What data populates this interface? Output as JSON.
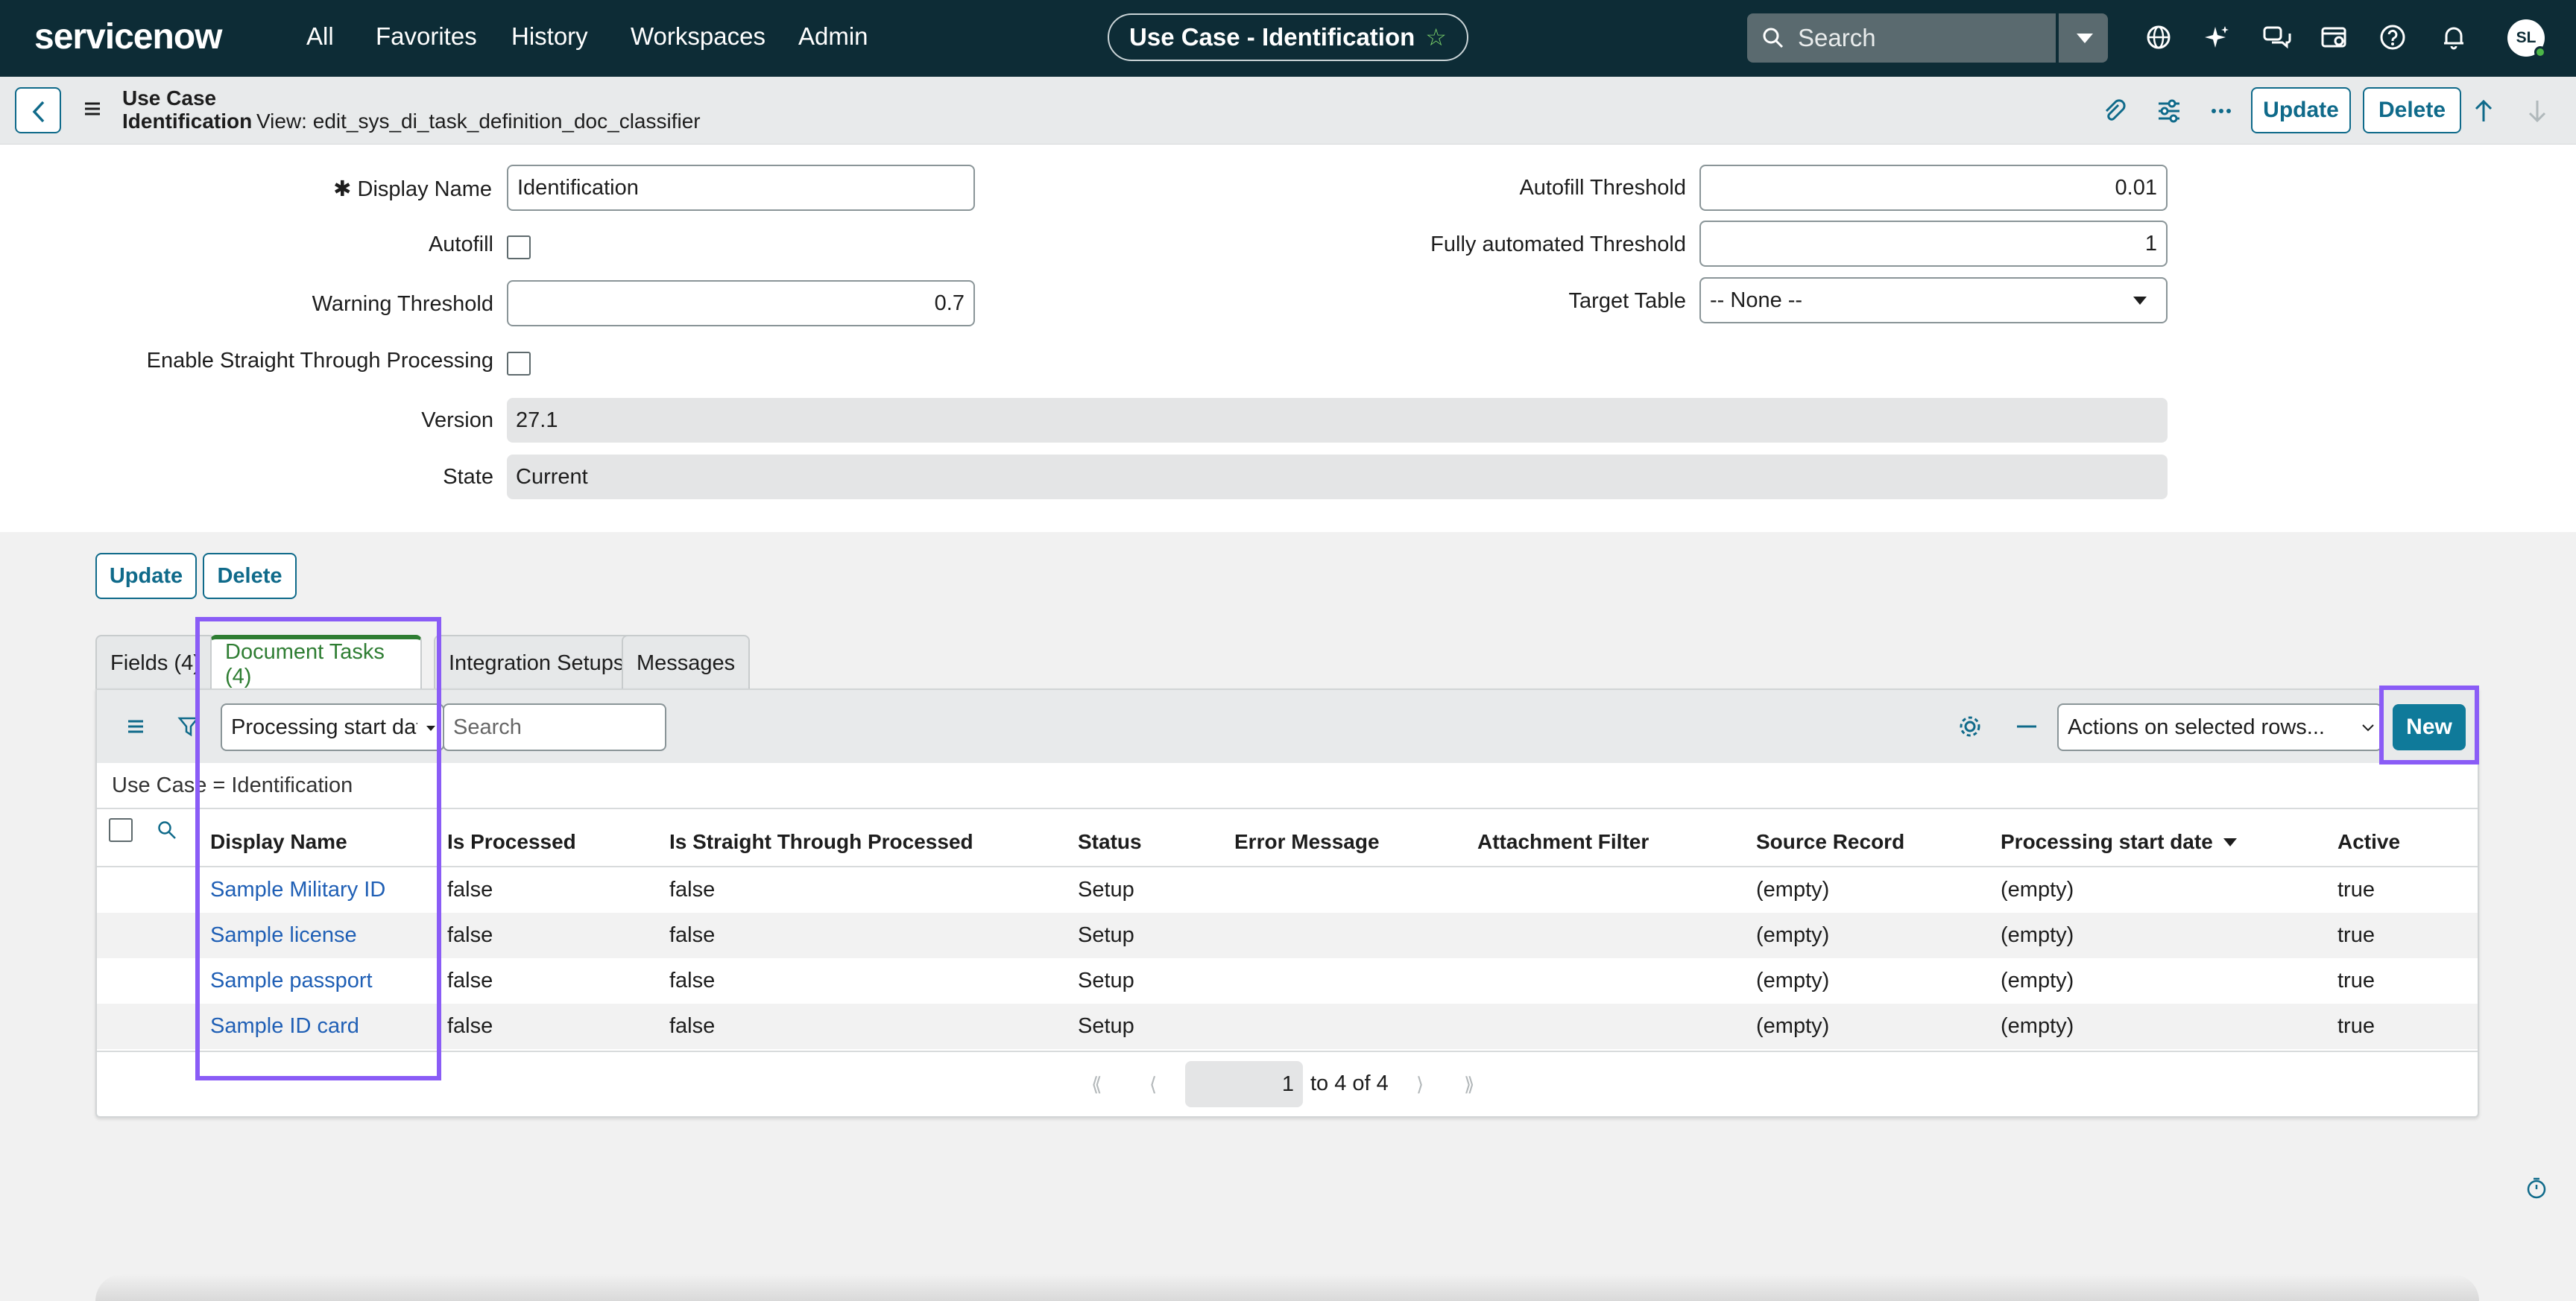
{
  "nav": {
    "brand": "servicenow",
    "links": [
      "All",
      "Favorites",
      "History",
      "Workspaces",
      "Admin"
    ],
    "context_title": "Use Case - Identification",
    "search_placeholder": "Search",
    "user_initials": "SL"
  },
  "form_header": {
    "title_line1": "Use Case",
    "title_line2": "Identification",
    "view": "View: edit_sys_di_task_definition_doc_classifier",
    "update_label": "Update",
    "delete_label": "Delete"
  },
  "form": {
    "display_name_label": "Display Name",
    "display_name_value": "Identification",
    "autofill_label": "Autofill",
    "warning_threshold_label": "Warning Threshold",
    "warning_threshold_value": "0.7",
    "straight_through_label": "Enable Straight Through Processing",
    "autofill_threshold_label": "Autofill Threshold",
    "autofill_threshold_value": "0.01",
    "fully_automated_label": "Fully automated Threshold",
    "fully_automated_value": "1",
    "target_table_label": "Target Table",
    "target_table_value": "-- None --",
    "version_label": "Version",
    "version_value": "27.1",
    "state_label": "State",
    "state_value": "Current",
    "update_label": "Update",
    "delete_label": "Delete"
  },
  "tabs": [
    {
      "label": "Fields (4)"
    },
    {
      "label": "Document Tasks (4)"
    },
    {
      "label": "Integration Setups"
    },
    {
      "label": "Messages"
    }
  ],
  "list": {
    "filter_field": "Processing start date",
    "search_placeholder": "Search",
    "actions_select": "Actions on selected rows...",
    "new_label": "New",
    "breadcrumb": "Use Case = Identification",
    "columns": [
      "Display Name",
      "Is Processed",
      "Is Straight Through Processed",
      "Status",
      "Error Message",
      "Attachment Filter",
      "Source Record",
      "Processing start date",
      "Active"
    ],
    "rows": [
      {
        "name": "Sample Military ID",
        "processed": "false",
        "stp": "false",
        "status": "Setup",
        "error": "",
        "filter": "",
        "source": "(empty)",
        "start": "(empty)",
        "active": "true"
      },
      {
        "name": "Sample license",
        "processed": "false",
        "stp": "false",
        "status": "Setup",
        "error": "",
        "filter": "",
        "source": "(empty)",
        "start": "(empty)",
        "active": "true"
      },
      {
        "name": "Sample passport",
        "processed": "false",
        "stp": "false",
        "status": "Setup",
        "error": "",
        "filter": "",
        "source": "(empty)",
        "start": "(empty)",
        "active": "true"
      },
      {
        "name": "Sample ID card",
        "processed": "false",
        "stp": "false",
        "status": "Setup",
        "error": "",
        "filter": "",
        "source": "(empty)",
        "start": "(empty)",
        "active": "true"
      }
    ],
    "pager_page": "1",
    "pager_text": "to 4 of 4"
  },
  "colors": {
    "nav_bg": "#0d2c36",
    "accent": "#0f6a8a",
    "highlight": "#8a5cf6",
    "active_tab": "#2e7d32"
  }
}
